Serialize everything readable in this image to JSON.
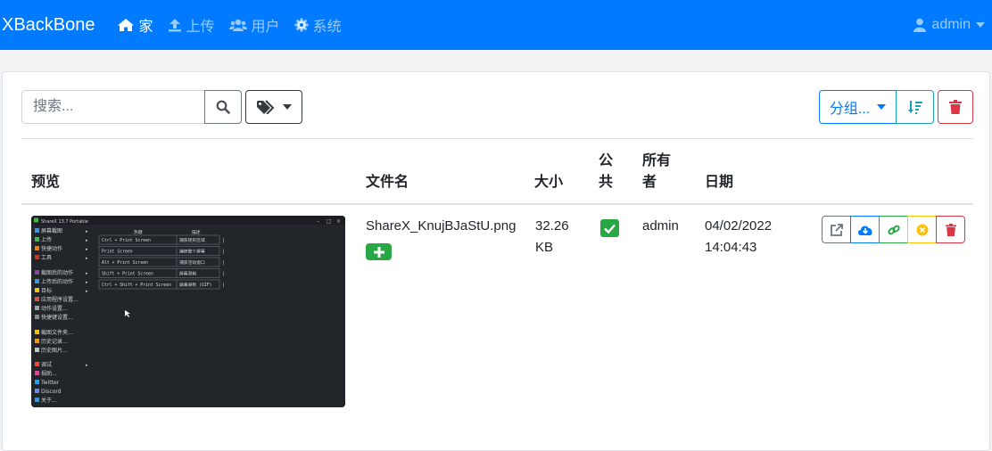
{
  "nav": {
    "brand": "XBackBone",
    "items": [
      {
        "label": "家",
        "icon": "home-icon",
        "active": true
      },
      {
        "label": "上传",
        "icon": "upload-icon",
        "active": false
      },
      {
        "label": "用户",
        "icon": "users-icon",
        "active": false
      },
      {
        "label": "系统",
        "icon": "cog-icon",
        "active": false
      }
    ],
    "user": "admin"
  },
  "toolbar": {
    "search_placeholder": "搜索...",
    "group_label": "分组...",
    "search_icon": "search-icon",
    "tags_icon": "tags-icon",
    "sort_icon": "sort-amount-icon",
    "trash_icon": "trash-icon"
  },
  "table": {
    "headers": {
      "preview": "预览",
      "filename": "文件名",
      "size": "大小",
      "public_line1": "公",
      "public_line2": "共",
      "owner_line1": "所有",
      "owner_line2": "者",
      "date": "日期"
    },
    "rows": [
      {
        "filename": "ShareX_KnujBJaStU.png",
        "size_line1": "32.26",
        "size_line2": "KB",
        "public": true,
        "owner": "admin",
        "date_line1": "04/02/2022",
        "date_line2": "14:04:43",
        "actions": [
          "external-link-icon",
          "cloud-download-icon",
          "link-icon",
          "times-circle-icon",
          "trash-icon"
        ]
      }
    ]
  },
  "thumbnail": {
    "title": "ShareX 13.7 Portable",
    "menu": [
      "屏幕截图",
      "上传",
      "快捷动作",
      "工具",
      "截图后的动作",
      "上传后的动作",
      "目标",
      "应用程序设置...",
      "动作设置...",
      "快捷键设置...",
      "截图文件夹...",
      "历史记录...",
      "历史图片...",
      "调试",
      "捐助...",
      "Twitter",
      "Discord",
      "关于..."
    ],
    "col_hotkey": "热键",
    "col_desc": "描述",
    "hotkeys": [
      {
        "key": "Ctrl + Print Screen",
        "desc": "捕获矩形区域"
      },
      {
        "key": "Print Screen",
        "desc": "捕获整个屏幕"
      },
      {
        "key": "Alt + Print Screen",
        "desc": "捕获活动窗口"
      },
      {
        "key": "Shift + Print Screen",
        "desc": "屏幕录制"
      },
      {
        "key": "Ctrl + Shift + Print Screen",
        "desc": "屏幕录制 (GIF)"
      }
    ]
  },
  "colors": {
    "primary": "#007bff",
    "success": "#28a745",
    "danger": "#dc3545",
    "info": "#17a2b8",
    "warning": "#ffc107",
    "secondary": "#6c757d"
  }
}
